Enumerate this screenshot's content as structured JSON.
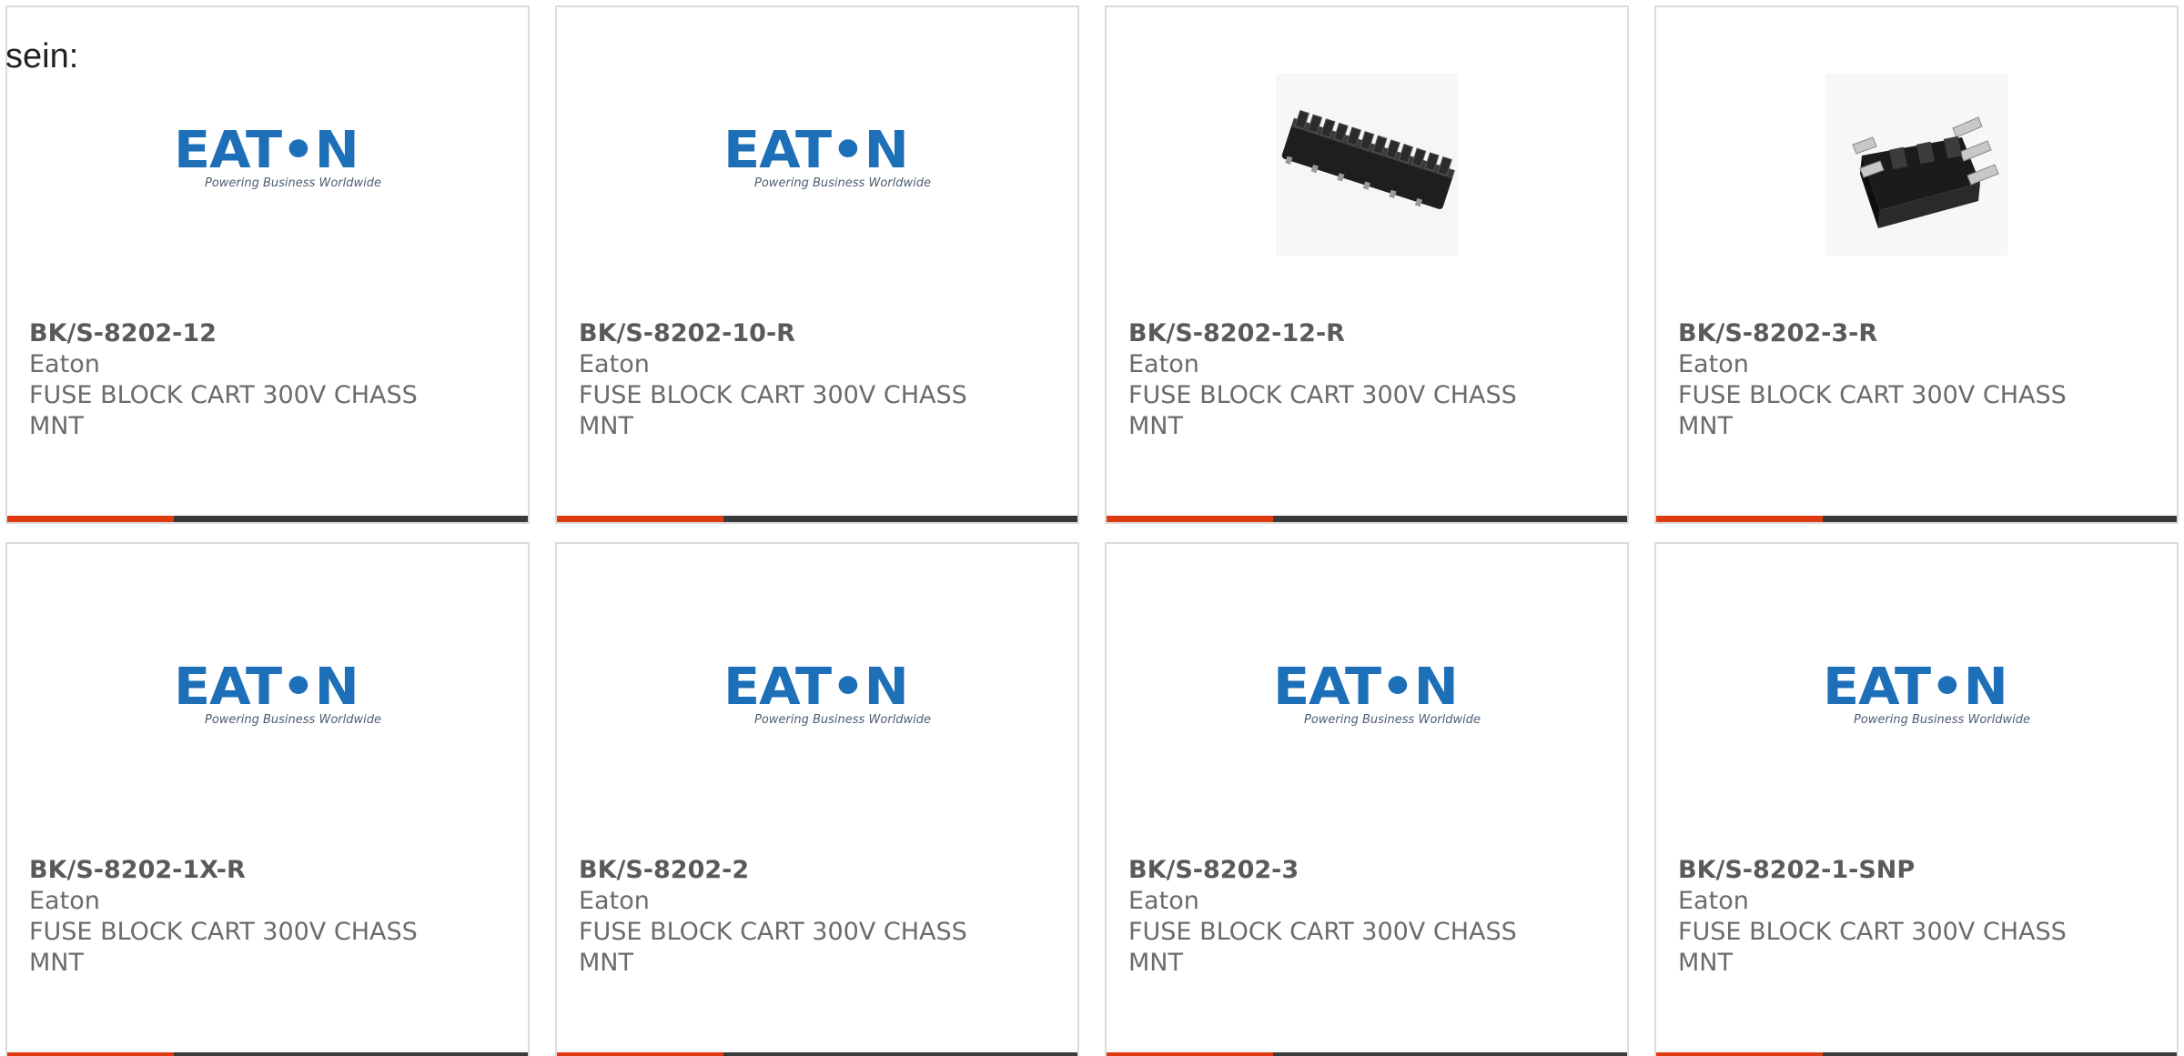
{
  "intro_text": "sein:",
  "colors": {
    "accent_bar": "#e03a12",
    "bar_base": "#3a3a3a",
    "eaton_blue": "#1d6fb8"
  },
  "products": [
    {
      "part_number": "BK/S-8202-12",
      "manufacturer": "Eaton",
      "description": "FUSE BLOCK CART 300V CHASS MNT",
      "image": "eaton-logo",
      "logo_text": "EAT•N",
      "logo_tagline": "Powering Business Worldwide"
    },
    {
      "part_number": "BK/S-8202-10-R",
      "manufacturer": "Eaton",
      "description": "FUSE BLOCK CART 300V CHASS MNT",
      "image": "eaton-logo",
      "logo_text": "EAT•N",
      "logo_tagline": "Powering Business Worldwide"
    },
    {
      "part_number": "BK/S-8202-12-R",
      "manufacturer": "Eaton",
      "description": "FUSE BLOCK CART 300V CHASS MNT",
      "image": "fuse-block-12-pole-photo"
    },
    {
      "part_number": "BK/S-8202-3-R",
      "manufacturer": "Eaton",
      "description": "FUSE BLOCK CART 300V CHASS MNT",
      "image": "fuse-block-3-pole-photo"
    },
    {
      "part_number": "BK/S-8202-1X-R",
      "manufacturer": "Eaton",
      "description": "FUSE BLOCK CART 300V CHASS MNT",
      "image": "eaton-logo",
      "logo_text": "EAT•N",
      "logo_tagline": "Powering Business Worldwide"
    },
    {
      "part_number": "BK/S-8202-2",
      "manufacturer": "Eaton",
      "description": "FUSE BLOCK CART 300V CHASS MNT",
      "image": "eaton-logo",
      "logo_text": "EAT•N",
      "logo_tagline": "Powering Business Worldwide"
    },
    {
      "part_number": "BK/S-8202-3",
      "manufacturer": "Eaton",
      "description": "FUSE BLOCK CART 300V CHASS MNT",
      "image": "eaton-logo",
      "logo_text": "EAT•N",
      "logo_tagline": "Powering Business Worldwide"
    },
    {
      "part_number": "BK/S-8202-1-SNP",
      "manufacturer": "Eaton",
      "description": "FUSE BLOCK CART 300V CHASS MNT",
      "image": "eaton-logo",
      "logo_text": "EAT•N",
      "logo_tagline": "Powering Business Worldwide"
    }
  ]
}
